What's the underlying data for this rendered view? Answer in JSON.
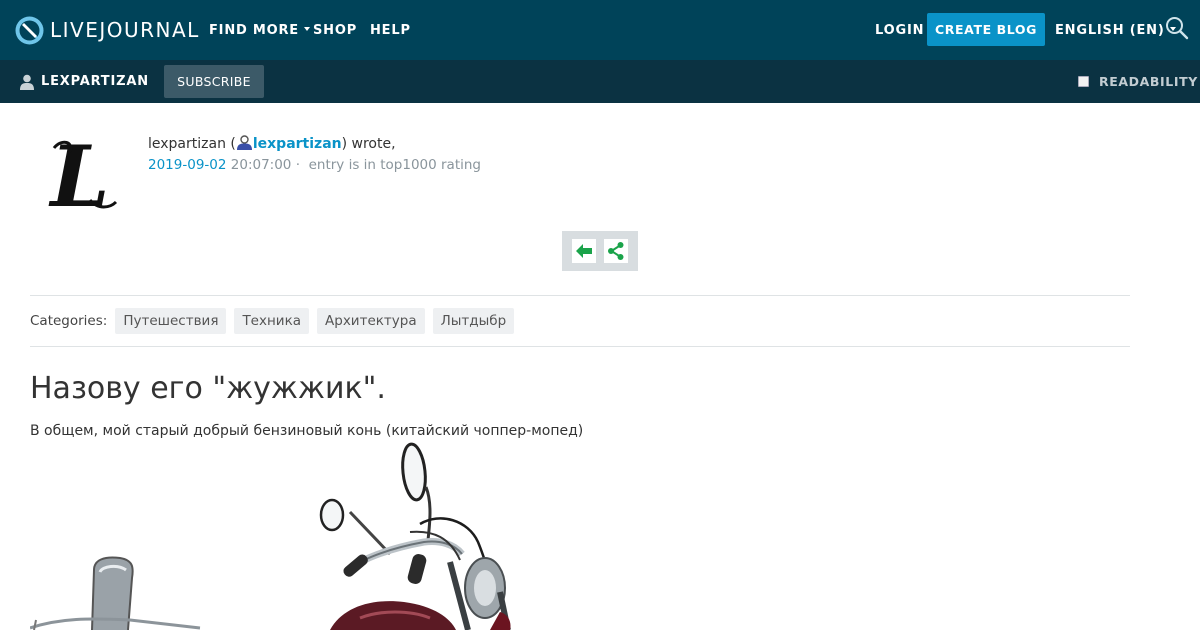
{
  "header": {
    "logo_text": "LIVEJOURNAL",
    "nav": {
      "find_more": "FIND MORE",
      "shop": "SHOP",
      "help": "HELP"
    },
    "login": "LOGIN",
    "create_blog": "CREATE BLOG",
    "language": "ENGLISH (EN)"
  },
  "subbar": {
    "journal_name": "LEXPARTIZAN",
    "subscribe": "SUBSCRIBE",
    "readability": "READABILITY"
  },
  "entry": {
    "author_plain": "lexpartizan (",
    "author_link": "lexpartizan",
    "wrote": ") wrote,",
    "date": "2019-09-02",
    "time": "20:07:00 ·",
    "rating": "entry is in top1000 rating",
    "categories_label": "Categories:",
    "categories": [
      "Путешествия",
      "Техника",
      "Архитектура",
      "Лытдыбр"
    ],
    "title": "Назову его \"жужжик\".",
    "lede": "В общем, мой старый добрый бензиновый конь (китайский чоппер-мопед)"
  },
  "colors": {
    "topbar": "#004359",
    "subbar": "#0b3242",
    "accent": "#0a93c8",
    "share_green": "#1aa34a"
  },
  "icons": {
    "logo": "livejournal-logo-icon",
    "search": "search-icon",
    "user": "user-icon",
    "back": "arrow-left-icon",
    "share": "share-icon"
  }
}
